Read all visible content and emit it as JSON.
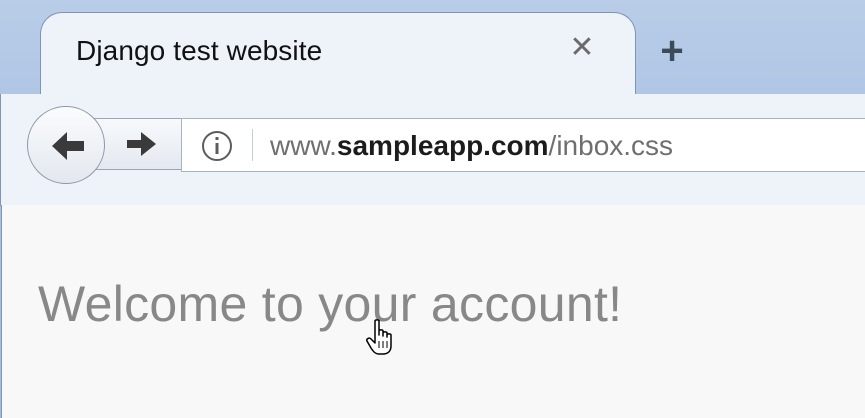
{
  "browser": {
    "tab_title": "Django test website",
    "tab_close_icon": "close-icon",
    "new_tab_icon": "plus-icon",
    "back_icon": "arrow-left-icon",
    "forward_icon": "arrow-right-icon",
    "site_info_icon": "info-icon"
  },
  "address_bar": {
    "prefix": "www.",
    "domain": "sampleapp.com",
    "path": "/inbox.css"
  },
  "page": {
    "heading": "Welcome to your account!"
  },
  "cursor": "hand-pointer-icon",
  "colors": {
    "frame": "#a9c1e2",
    "chrome": "#eef3fa",
    "content_bg": "#f8f8f8",
    "heading_text": "#888888"
  }
}
